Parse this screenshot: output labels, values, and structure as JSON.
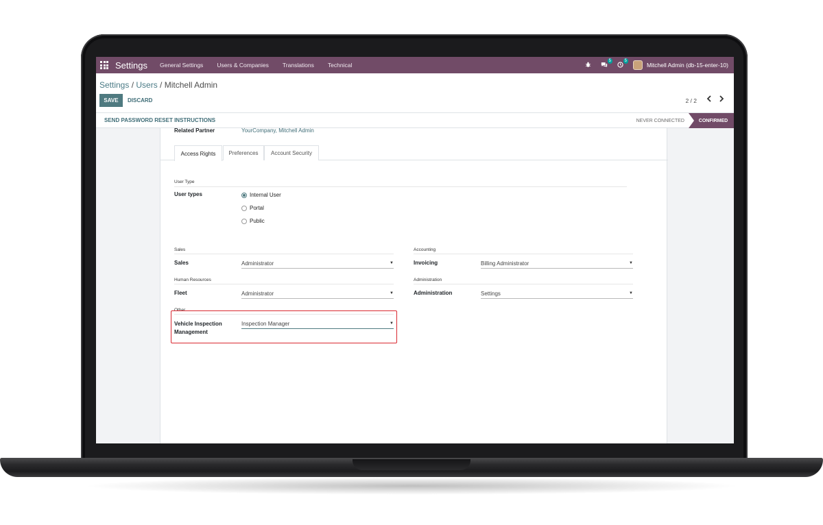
{
  "navbar": {
    "app_title": "Settings",
    "menu": [
      "General Settings",
      "Users & Companies",
      "Translations",
      "Technical"
    ],
    "messages_badge": "5",
    "activities_badge": "5",
    "user_name": "Mitchell Admin (db-15-enter-10)"
  },
  "breadcrumb": {
    "settings": "Settings",
    "sep1": " / ",
    "users": "Users",
    "sep2": " / ",
    "current": "Mitchell Admin"
  },
  "toolbar": {
    "save_label": "SAVE",
    "discard_label": "DISCARD"
  },
  "pager": {
    "text": "2 / 2"
  },
  "statusbar": {
    "reset_link": "SEND PASSWORD RESET INSTRUCTIONS",
    "never_connected": "NEVER CONNECTED",
    "confirmed": "CONFIRMED"
  },
  "form": {
    "related_partner_label": "Related Partner",
    "related_partner_value": "YourCompany, Mitchell Admin",
    "tabs": [
      "Access Rights",
      "Preferences",
      "Account Security"
    ],
    "user_type_section": "User Type",
    "user_types_label": "User types",
    "user_types_options": [
      "Internal User",
      "Portal",
      "Public"
    ],
    "user_types_selected": "Internal User",
    "sales_section": "Sales",
    "sales_label": "Sales",
    "sales_value": "Administrator",
    "accounting_section": "Accounting",
    "invoicing_label": "Invoicing",
    "invoicing_value": "Billing Administrator",
    "hr_section": "Human Resources",
    "fleet_label": "Fleet",
    "fleet_value": "Administrator",
    "administration_section": "Administration",
    "administration_label": "Administration",
    "administration_value": "Settings",
    "other_section": "Other",
    "vim_label_line1": "Vehicle Inspection",
    "vim_label_line2": "Management",
    "vim_value": "Inspection Manager"
  },
  "colors": {
    "navbar": "#714b67",
    "primary_button": "#4f7a80",
    "highlight_border": "#d9262e"
  }
}
